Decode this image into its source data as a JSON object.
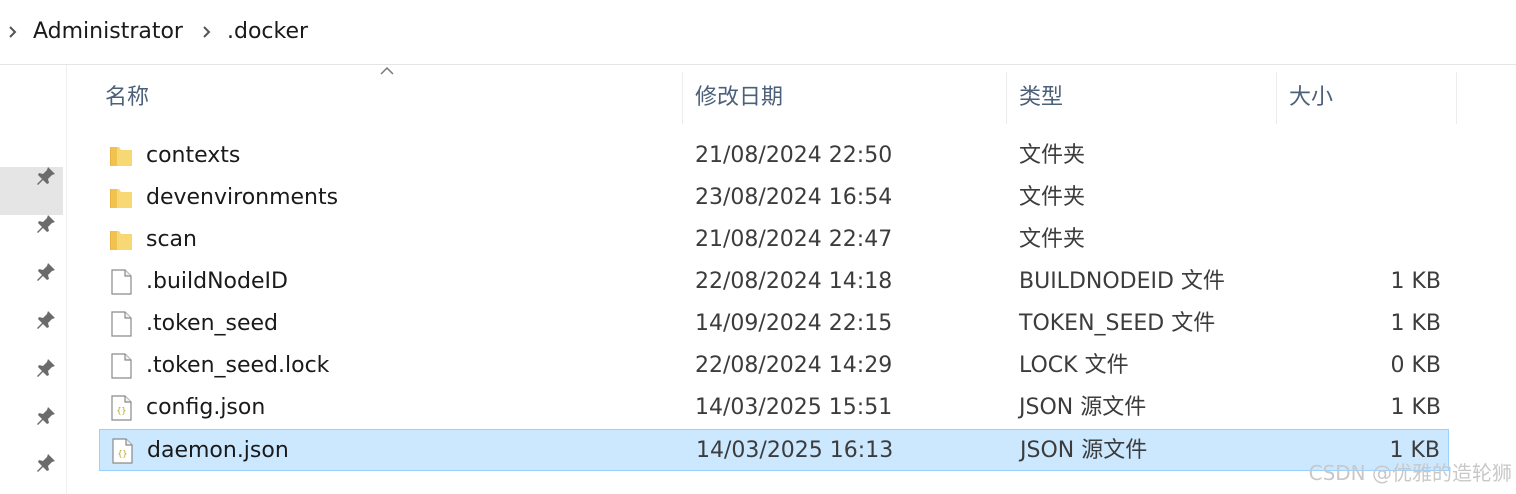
{
  "breadcrumb": {
    "items": [
      "Administrator",
      ".docker"
    ]
  },
  "columns": {
    "name": "名称",
    "date": "修改日期",
    "type": "类型",
    "size": "大小"
  },
  "files": [
    {
      "name": "contexts",
      "date": "21/08/2024 22:50",
      "type": "文件夹",
      "size": "",
      "icon": "folder-icon"
    },
    {
      "name": "devenvironments",
      "date": "23/08/2024 16:54",
      "type": "文件夹",
      "size": "",
      "icon": "folder-icon"
    },
    {
      "name": "scan",
      "date": "21/08/2024 22:47",
      "type": "文件夹",
      "size": "",
      "icon": "folder-icon"
    },
    {
      "name": ".buildNodeID",
      "date": "22/08/2024 14:18",
      "type": "BUILDNODEID 文件",
      "size": "1 KB",
      "icon": "file-icon"
    },
    {
      "name": ".token_seed",
      "date": "14/09/2024 22:15",
      "type": "TOKEN_SEED 文件",
      "size": "1 KB",
      "icon": "file-icon"
    },
    {
      "name": ".token_seed.lock",
      "date": "22/08/2024 14:29",
      "type": "LOCK 文件",
      "size": "0 KB",
      "icon": "file-icon"
    },
    {
      "name": "config.json",
      "date": "14/03/2025 15:51",
      "type": "JSON 源文件",
      "size": "1 KB",
      "icon": "json-file-icon"
    },
    {
      "name": "daemon.json",
      "date": "14/03/2025 16:13",
      "type": "JSON 源文件",
      "size": "1 KB",
      "icon": "json-file-icon",
      "selected": true
    }
  ],
  "watermark": "CSDN @优雅的造轮狮",
  "colors": {
    "selection_bg": "#cce8ff",
    "selection_border": "#99d1ff",
    "folder": "#f8d775",
    "header_text": "#4c607a"
  }
}
